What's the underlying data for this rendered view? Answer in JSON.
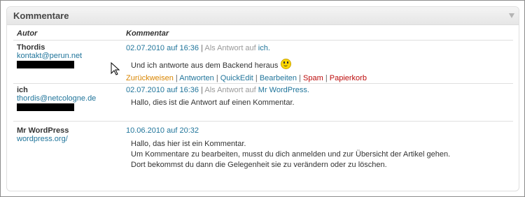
{
  "widget": {
    "title": "Kommentare",
    "col_author": "Autor",
    "col_comment": "Kommentar"
  },
  "comments": [
    {
      "author": "Thordis",
      "email": "kontakt@perun.net",
      "date": "02.07.2010 auf 16:36",
      "separator": "|",
      "reply_prefix": "Als Antwort auf",
      "reply_to": "ich.",
      "text": "Und ich antworte aus dem Backend heraus",
      "emoticon": "smiley-icon",
      "actions": {
        "reject": "Zurückweisen",
        "reply": "Antworten",
        "quickedit": "QuickEdit",
        "edit": "Bearbeiten",
        "spam": "Spam",
        "trash": "Papierkorb"
      }
    },
    {
      "author": "ich",
      "email": "thordis@netcologne.de",
      "date": "02.07.2010 auf 16:36",
      "separator": "|",
      "reply_prefix": "Als Antwort auf",
      "reply_to": "Mr WordPress.",
      "text": "Hallo, dies ist die Antwort auf einen Kommentar."
    },
    {
      "author": "Mr WordPress",
      "website": "wordpress.org/",
      "date": "10.06.2010 auf 20:32",
      "lines": [
        "Hallo, das hier ist ein Kommentar.",
        "Um Kommentare zu bearbeiten, musst du dich anmelden und zur Übersicht der Artikel gehen.",
        "Dort bekommst du dann die Gelegenheit sie zu verändern oder zu löschen."
      ]
    }
  ],
  "colors": {
    "link": "#21759b",
    "reject": "#d98500",
    "danger": "#bc0b0b"
  }
}
